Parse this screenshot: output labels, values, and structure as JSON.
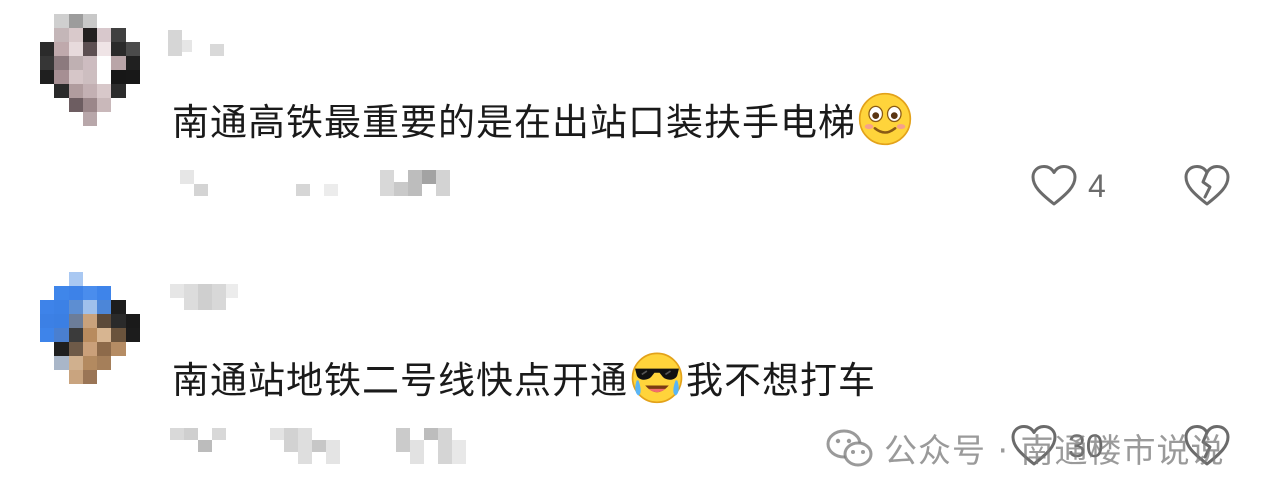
{
  "comments": [
    {
      "text_before_emoji": "南通高铁最重要的是在出站口装扶手电梯",
      "emoji": "smiling-face-emoji",
      "text_after_emoji": "",
      "like_count": "4",
      "has_dislike": true
    },
    {
      "text_before_emoji": "南通站地铁二号线快点开通",
      "emoji": "cool-crying-emoji",
      "text_after_emoji": "我不想打车",
      "like_count": "30",
      "has_dislike": true
    }
  ],
  "watermark": {
    "label": "公众号 · 南通楼市说说",
    "icon": "wechat-icon",
    "color": "#8a8a8a"
  },
  "colors": {
    "text": "#1a1a1a",
    "meta": "#6b6b6b",
    "background": "#ffffff"
  }
}
